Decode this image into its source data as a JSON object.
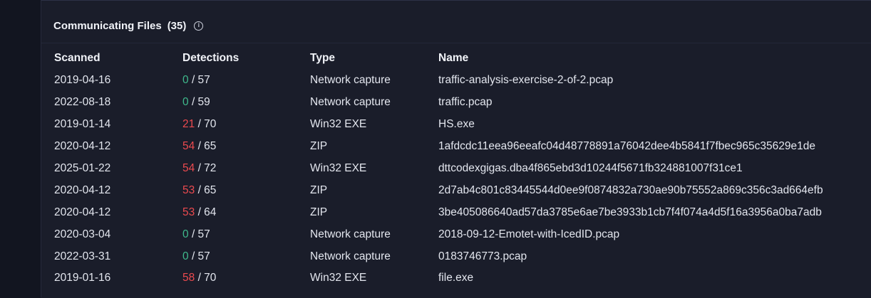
{
  "section": {
    "title": "Communicating Files",
    "count": "(35)",
    "info_icon": "info-icon"
  },
  "colors": {
    "clean": "#3fb98c",
    "malicious": "#ec4a4f",
    "background": "#1a1d2a"
  },
  "table": {
    "columns": [
      "Scanned",
      "Detections",
      "Type",
      "Name"
    ],
    "rows": [
      {
        "scanned": "2019-04-16",
        "positives": "0",
        "total": "/ 57",
        "type": "Network capture",
        "name": "traffic-analysis-exercise-2-of-2.pcap"
      },
      {
        "scanned": "2022-08-18",
        "positives": "0",
        "total": "/ 59",
        "type": "Network capture",
        "name": "traffic.pcap"
      },
      {
        "scanned": "2019-01-14",
        "positives": "21",
        "total": "/ 70",
        "type": "Win32 EXE",
        "name": "HS.exe"
      },
      {
        "scanned": "2020-04-12",
        "positives": "54",
        "total": "/ 65",
        "type": "ZIP",
        "name": "1afdcdc11eea96eeafc04d48778891a76042dee4b5841f7fbec965c35629e1de"
      },
      {
        "scanned": "2025-01-22",
        "positives": "54",
        "total": "/ 72",
        "type": "Win32 EXE",
        "name": "dttcodexgigas.dba4f865ebd3d10244f5671fb324881007f31ce1"
      },
      {
        "scanned": "2020-04-12",
        "positives": "53",
        "total": "/ 65",
        "type": "ZIP",
        "name": "2d7ab4c801c83445544d0ee9f0874832a730ae90b75552a869c356c3ad664efb"
      },
      {
        "scanned": "2020-04-12",
        "positives": "53",
        "total": "/ 64",
        "type": "ZIP",
        "name": "3be405086640ad57da3785e6ae7be3933b1cb7f4f074a4d5f16a3956a0ba7adb"
      },
      {
        "scanned": "2020-03-04",
        "positives": "0",
        "total": "/ 57",
        "type": "Network capture",
        "name": "2018-09-12-Emotet-with-IcedID.pcap"
      },
      {
        "scanned": "2022-03-31",
        "positives": "0",
        "total": "/ 57",
        "type": "Network capture",
        "name": "0183746773.pcap"
      },
      {
        "scanned": "2019-01-16",
        "positives": "58",
        "total": "/ 70",
        "type": "Win32 EXE",
        "name": "file.exe"
      }
    ]
  }
}
